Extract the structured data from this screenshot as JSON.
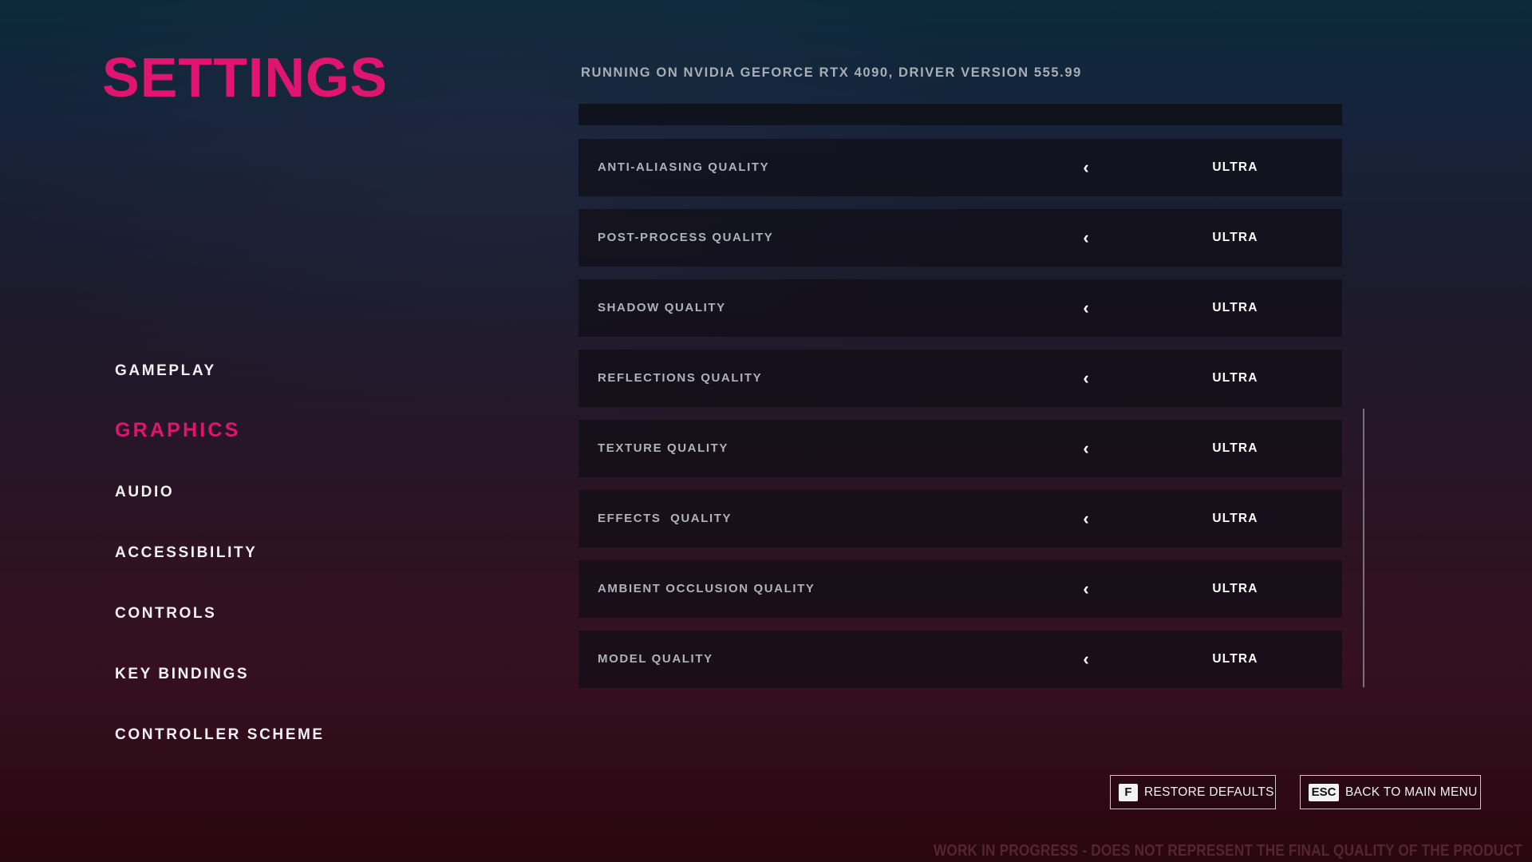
{
  "page": {
    "title": "SETTINGS",
    "gpu_info": "RUNNING ON NVIDIA GEFORCE RTX 4090, DRIVER VERSION 555.99",
    "watermark": "WORK IN PROGRESS - DOES NOT REPRESENT THE FINAL QUALITY OF THE PRODUCT"
  },
  "colors": {
    "accent": "#e0156f",
    "text": "#f1f1f4",
    "muted_text": "#aeb2bc"
  },
  "nav": {
    "active": "GRAPHICS",
    "items": [
      {
        "label": "GAMEPLAY"
      },
      {
        "label": "GRAPHICS"
      },
      {
        "label": "AUDIO"
      },
      {
        "label": "ACCESSIBILITY"
      },
      {
        "label": "CONTROLS"
      },
      {
        "label": "KEY BINDINGS"
      },
      {
        "label": "CONTROLLER SCHEME"
      }
    ]
  },
  "settings": {
    "decrease_icon": "chevron-left-icon",
    "rows": [
      {
        "label": "ANTI-ALIASING QUALITY",
        "value": "ULTRA"
      },
      {
        "label": "POST-PROCESS QUALITY",
        "value": "ULTRA"
      },
      {
        "label": "SHADOW QUALITY",
        "value": "ULTRA"
      },
      {
        "label": "REFLECTIONS QUALITY",
        "value": "ULTRA"
      },
      {
        "label": "TEXTURE QUALITY",
        "value": "ULTRA"
      },
      {
        "label": "EFFECTS  QUALITY",
        "value": "ULTRA"
      },
      {
        "label": "AMBIENT OCCLUSION QUALITY",
        "value": "ULTRA"
      },
      {
        "label": "MODEL QUALITY",
        "value": "ULTRA"
      }
    ]
  },
  "footer": {
    "restore": {
      "key": "F",
      "label": "RESTORE DEFAULTS"
    },
    "back": {
      "key": "ESC",
      "label": "BACK TO MAIN MENU"
    }
  }
}
